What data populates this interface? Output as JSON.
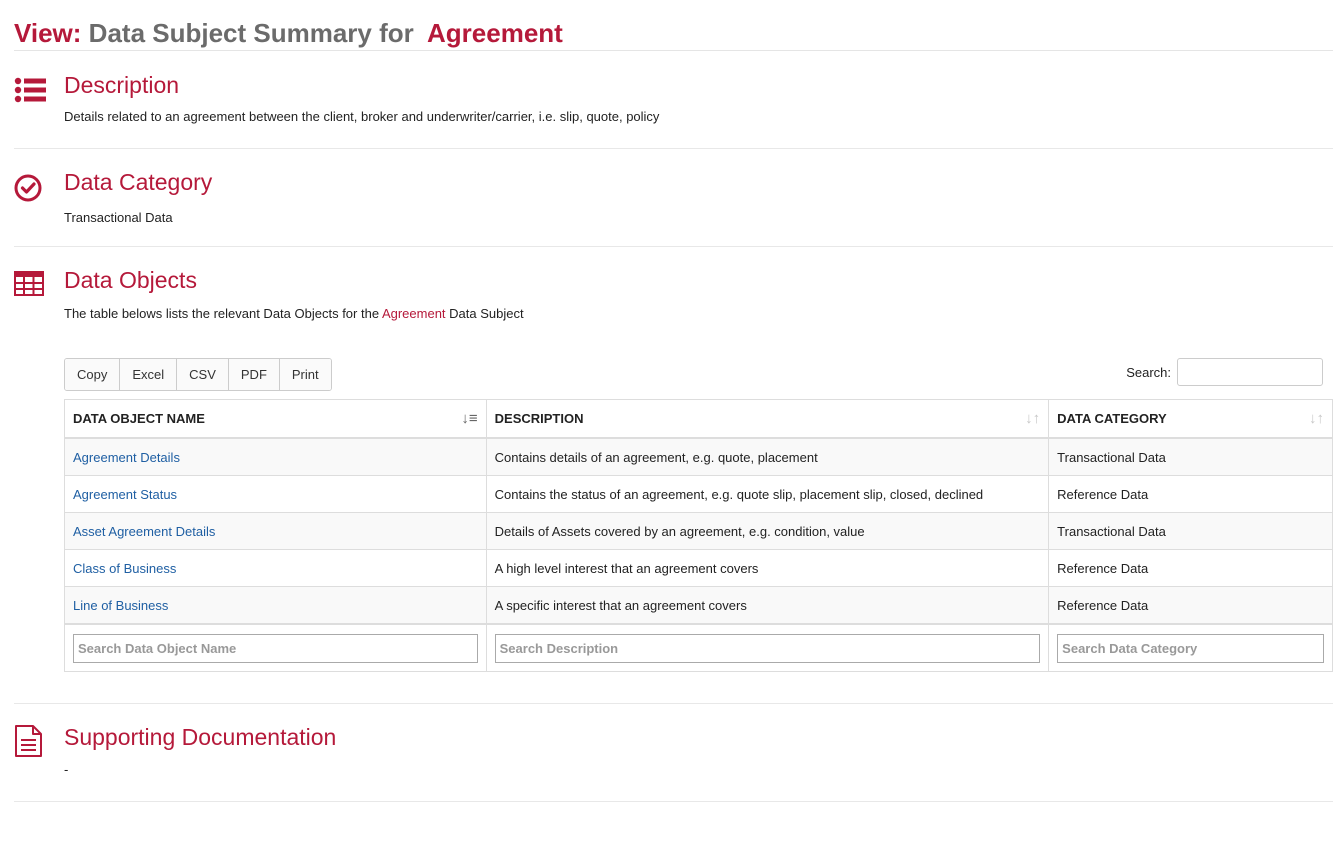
{
  "title": {
    "prefix": "View:",
    "main": "Data Subject Summary for",
    "subject": "Agreement"
  },
  "description": {
    "heading": "Description",
    "text": "Details related to an agreement between the client, broker and underwriter/carrier, i.e. slip, quote, policy",
    "icon": "list-icon"
  },
  "data_category": {
    "heading": "Data Category",
    "text": "Transactional Data",
    "icon": "check-circle-icon"
  },
  "data_objects": {
    "heading": "Data Objects",
    "text_before": "The table belows lists the relevant Data Objects for the",
    "text_link": "Agreement",
    "text_after": "Data Subject",
    "icon": "table-icon",
    "toolbar": [
      "Copy",
      "Excel",
      "CSV",
      "PDF",
      "Print"
    ],
    "search_label": "Search:",
    "columns": [
      "DATA OBJECT NAME",
      "DESCRIPTION",
      "DATA CATEGORY"
    ],
    "rows": [
      {
        "name": "Agreement Details",
        "description": "Contains details of an agreement, e.g. quote, placement",
        "category": "Transactional Data"
      },
      {
        "name": "Agreement Status",
        "description": "Contains the status of an agreement, e.g. quote slip, placement slip, closed, declined",
        "category": "Reference Data"
      },
      {
        "name": "Asset Agreement Details",
        "description": "Details of Assets covered by an agreement, e.g. condition, value",
        "category": "Transactional Data"
      },
      {
        "name": "Class of Business",
        "description": "A high level interest that an agreement covers",
        "category": "Reference Data"
      },
      {
        "name": "Line of Business",
        "description": "A specific interest that an agreement covers",
        "category": "Reference Data"
      }
    ],
    "footer_placeholders": [
      "Search Data Object Name",
      "Search Description",
      "Search Data Category"
    ]
  },
  "supporting_documentation": {
    "heading": "Supporting Documentation",
    "text": "-",
    "icon": "document-icon"
  },
  "colors": {
    "accent": "#b5193a",
    "link": "#1f5fa3"
  }
}
